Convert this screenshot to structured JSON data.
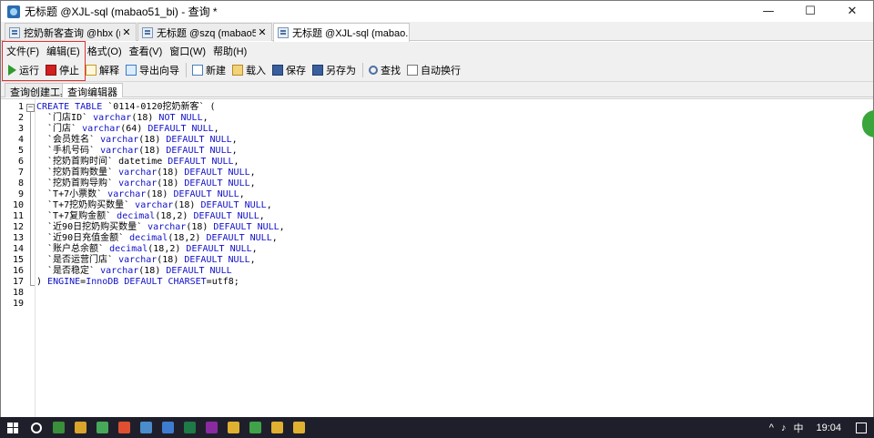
{
  "window": {
    "title": "无标题 @XJL-sql (mabao51_bi) - 查询 *",
    "controls": [
      "—",
      "☐",
      "✕"
    ]
  },
  "tabs": [
    {
      "label": "挖奶新客查询 @hbx (m...",
      "close": "✕"
    },
    {
      "label": "无标题 @szq (mabao51...",
      "close": "✕"
    },
    {
      "label": "无标题 @XJL-sql (mabao...",
      "close": ""
    }
  ],
  "menu": [
    "文件(F)",
    "编辑(E)",
    "格式(O)",
    "查看(V)",
    "窗口(W)",
    "帮助(H)"
  ],
  "toolbar": {
    "run": "运行",
    "stop": "停止",
    "explain": "解释",
    "export": "导出向导",
    "new": "新建",
    "load": "载入",
    "save": "保存",
    "saveas": "另存为",
    "find": "查找",
    "wrap": "自动换行"
  },
  "subtabs": [
    "查询创建工具",
    "查询编辑器"
  ],
  "editor": {
    "line_numbers": [
      "1",
      "2",
      "3",
      "4",
      "5",
      "6",
      "7",
      "8",
      "9",
      "10",
      "11",
      "12",
      "13",
      "14",
      "15",
      "16",
      "17",
      "18",
      "19"
    ],
    "fold_marker": "−",
    "lines": [
      [
        {
          "t": "CREATE TABLE ",
          "c": "kw"
        },
        {
          "t": "`0114-0120挖奶新客` (",
          "c": "id"
        }
      ],
      [
        {
          "t": "  `门店ID` ",
          "c": "id"
        },
        {
          "t": "varchar",
          "c": "kw"
        },
        {
          "t": "(18) ",
          "c": "num"
        },
        {
          "t": "NOT NULL",
          "c": "kw"
        },
        {
          "t": ",",
          "c": "id"
        }
      ],
      [
        {
          "t": "  `门店` ",
          "c": "id"
        },
        {
          "t": "varchar",
          "c": "kw"
        },
        {
          "t": "(64) ",
          "c": "num"
        },
        {
          "t": "DEFAULT NULL",
          "c": "kw"
        },
        {
          "t": ",",
          "c": "id"
        }
      ],
      [
        {
          "t": "  `会员姓名` ",
          "c": "id"
        },
        {
          "t": "varchar",
          "c": "kw"
        },
        {
          "t": "(18) ",
          "c": "num"
        },
        {
          "t": "DEFAULT NULL",
          "c": "kw"
        },
        {
          "t": ",",
          "c": "id"
        }
      ],
      [
        {
          "t": "  `手机号码` ",
          "c": "id"
        },
        {
          "t": "varchar",
          "c": "kw"
        },
        {
          "t": "(18) ",
          "c": "num"
        },
        {
          "t": "DEFAULT NULL",
          "c": "kw"
        },
        {
          "t": ",",
          "c": "id"
        }
      ],
      [
        {
          "t": "  `挖奶首购时间` ",
          "c": "id"
        },
        {
          "t": "datetime ",
          "c": "id"
        },
        {
          "t": "DEFAULT NULL",
          "c": "kw"
        },
        {
          "t": ",",
          "c": "id"
        }
      ],
      [
        {
          "t": "  `挖奶首购数量` ",
          "c": "id"
        },
        {
          "t": "varchar",
          "c": "kw"
        },
        {
          "t": "(18) ",
          "c": "num"
        },
        {
          "t": "DEFAULT NULL",
          "c": "kw"
        },
        {
          "t": ",",
          "c": "id"
        }
      ],
      [
        {
          "t": "  `挖奶首购导购` ",
          "c": "id"
        },
        {
          "t": "varchar",
          "c": "kw"
        },
        {
          "t": "(18) ",
          "c": "num"
        },
        {
          "t": "DEFAULT NULL",
          "c": "kw"
        },
        {
          "t": ",",
          "c": "id"
        }
      ],
      [
        {
          "t": "  `T+7小票数` ",
          "c": "id"
        },
        {
          "t": "varchar",
          "c": "kw"
        },
        {
          "t": "(18) ",
          "c": "num"
        },
        {
          "t": "DEFAULT NULL",
          "c": "kw"
        },
        {
          "t": ",",
          "c": "id"
        }
      ],
      [
        {
          "t": "  `T+7挖奶购买数量` ",
          "c": "id"
        },
        {
          "t": "varchar",
          "c": "kw"
        },
        {
          "t": "(18) ",
          "c": "num"
        },
        {
          "t": "DEFAULT NULL",
          "c": "kw"
        },
        {
          "t": ",",
          "c": "id"
        }
      ],
      [
        {
          "t": "  `T+7复购金额` ",
          "c": "id"
        },
        {
          "t": "decimal",
          "c": "kw"
        },
        {
          "t": "(18,2) ",
          "c": "num"
        },
        {
          "t": "DEFAULT NULL",
          "c": "kw"
        },
        {
          "t": ",",
          "c": "id"
        }
      ],
      [
        {
          "t": "  `近90日挖奶购买数量` ",
          "c": "id"
        },
        {
          "t": "varchar",
          "c": "kw"
        },
        {
          "t": "(18) ",
          "c": "num"
        },
        {
          "t": "DEFAULT NULL",
          "c": "kw"
        },
        {
          "t": ",",
          "c": "id"
        }
      ],
      [
        {
          "t": "  `近90日充值金额` ",
          "c": "id"
        },
        {
          "t": "decimal",
          "c": "kw"
        },
        {
          "t": "(18,2) ",
          "c": "num"
        },
        {
          "t": "DEFAULT NULL",
          "c": "kw"
        },
        {
          "t": ",",
          "c": "id"
        }
      ],
      [
        {
          "t": "  `账户总余额` ",
          "c": "id"
        },
        {
          "t": "decimal",
          "c": "kw"
        },
        {
          "t": "(18,2) ",
          "c": "num"
        },
        {
          "t": "DEFAULT NULL",
          "c": "kw"
        },
        {
          "t": ",",
          "c": "id"
        }
      ],
      [
        {
          "t": "  `是否运营门店` ",
          "c": "id"
        },
        {
          "t": "varchar",
          "c": "kw"
        },
        {
          "t": "(18) ",
          "c": "num"
        },
        {
          "t": "DEFAULT NULL",
          "c": "kw"
        },
        {
          "t": ",",
          "c": "id"
        }
      ],
      [
        {
          "t": "  `是否稳定` ",
          "c": "id"
        },
        {
          "t": "varchar",
          "c": "kw"
        },
        {
          "t": "(18) ",
          "c": "num"
        },
        {
          "t": "DEFAULT NULL",
          "c": "kw"
        }
      ],
      [
        {
          "t": ") ",
          "c": "id"
        },
        {
          "t": "ENGINE",
          "c": "kw"
        },
        {
          "t": "=",
          "c": "id"
        },
        {
          "t": "InnoDB ",
          "c": "kw"
        },
        {
          "t": "DEFAULT CHARSET",
          "c": "kw"
        },
        {
          "t": "=utf8;",
          "c": "id"
        }
      ],
      [],
      []
    ]
  },
  "taskbar": {
    "ime": "中",
    "time": "19:04",
    "apps": [
      "#3a8f3a",
      "#d9a52b",
      "#48a85a",
      "#e05030",
      "#4a8ccc",
      "#3e7ccf",
      "#1e7a46",
      "#8a2aa0",
      "#e0b030",
      "#3fa34a",
      "#e0b030",
      "#e0b030"
    ]
  },
  "colors": {
    "keyword": "#1010c8",
    "highlight_box": "#e03030"
  }
}
